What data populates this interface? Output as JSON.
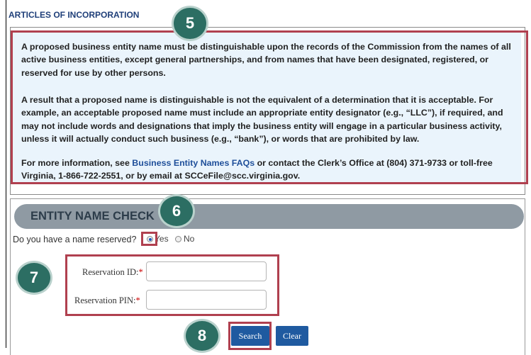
{
  "section_title": "ARTICLES OF INCORPORATION",
  "info": {
    "p1": "A proposed business entity name must be distinguishable upon the records of the Commission from the names of all active business entities, except general partnerships, and from names that have been designated, registered, or reserved for use by other persons.",
    "p2": "A result that a proposed name is distinguishable is not the equivalent of a determination that it is acceptable. For example, an acceptable proposed name must include an appropriate entity designator (e.g., “LLC”), if required, and may not include words and designations that imply the business entity will engage in a particular business activity, unless it will actually conduct such business (e.g., “bank”), or words that are prohibited by law.",
    "p3_before": "For more information, see ",
    "p3_link": "Business Entity Names FAQs",
    "p3_after": " or contact the Clerk’s Office at (804) 371-9733 or toll-free Virginia, 1-866-722-2551, or by email at SCCeFile@scc.virginia.gov."
  },
  "entity_check": {
    "title": "ENTITY NAME CHECK",
    "question": "Do you have a name reserved?",
    "yes_label": "Yes",
    "no_label": "No",
    "reservation_id_label": "Reservation ID:",
    "reservation_pin_label": "Reservation PIN:",
    "required_mark": "*",
    "reservation_id_value": "",
    "reservation_pin_value": "",
    "search_label": "Search",
    "clear_label": "Clear"
  },
  "callouts": {
    "c5": "5",
    "c6": "6",
    "c7": "7",
    "c8": "8"
  },
  "colors": {
    "highlight": "#b0404f",
    "callout": "#2c6e63",
    "button": "#1f5aa0"
  }
}
